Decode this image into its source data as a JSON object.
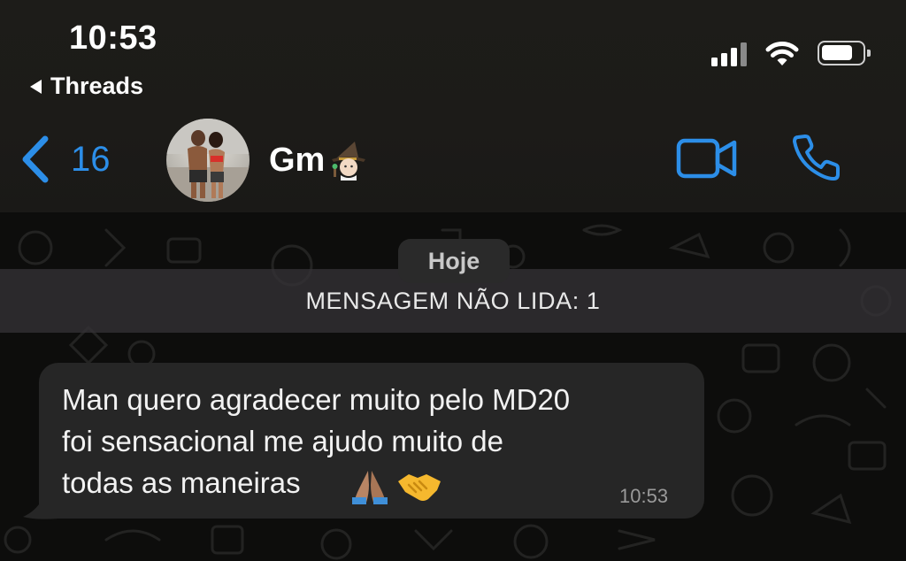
{
  "status_bar": {
    "time": "10:53",
    "back_app_label": "Threads"
  },
  "header": {
    "back_count": "16",
    "contact_name": "Gm",
    "name_emoji_icon": "witch-emoji-icon",
    "video_call_icon": "video-camera-icon",
    "voice_call_icon": "phone-icon"
  },
  "chat": {
    "date_label": "Hoje",
    "unread_label": "MENSAGEM NÃO LIDA: 1",
    "messages": [
      {
        "lines": [
          "Man quero agradecer muito pelo MD20",
          "foi sensacional me ajudo muito de",
          "todas as maneiras"
        ],
        "emoji_icons": [
          "folded-hands-icon",
          "handshake-icon"
        ],
        "time": "10:53"
      }
    ]
  },
  "colors": {
    "accent": "#2c8ee8",
    "header_bg": "#1c1b18",
    "bubble_bg": "#262626",
    "unread_bar_bg": "#343236"
  }
}
